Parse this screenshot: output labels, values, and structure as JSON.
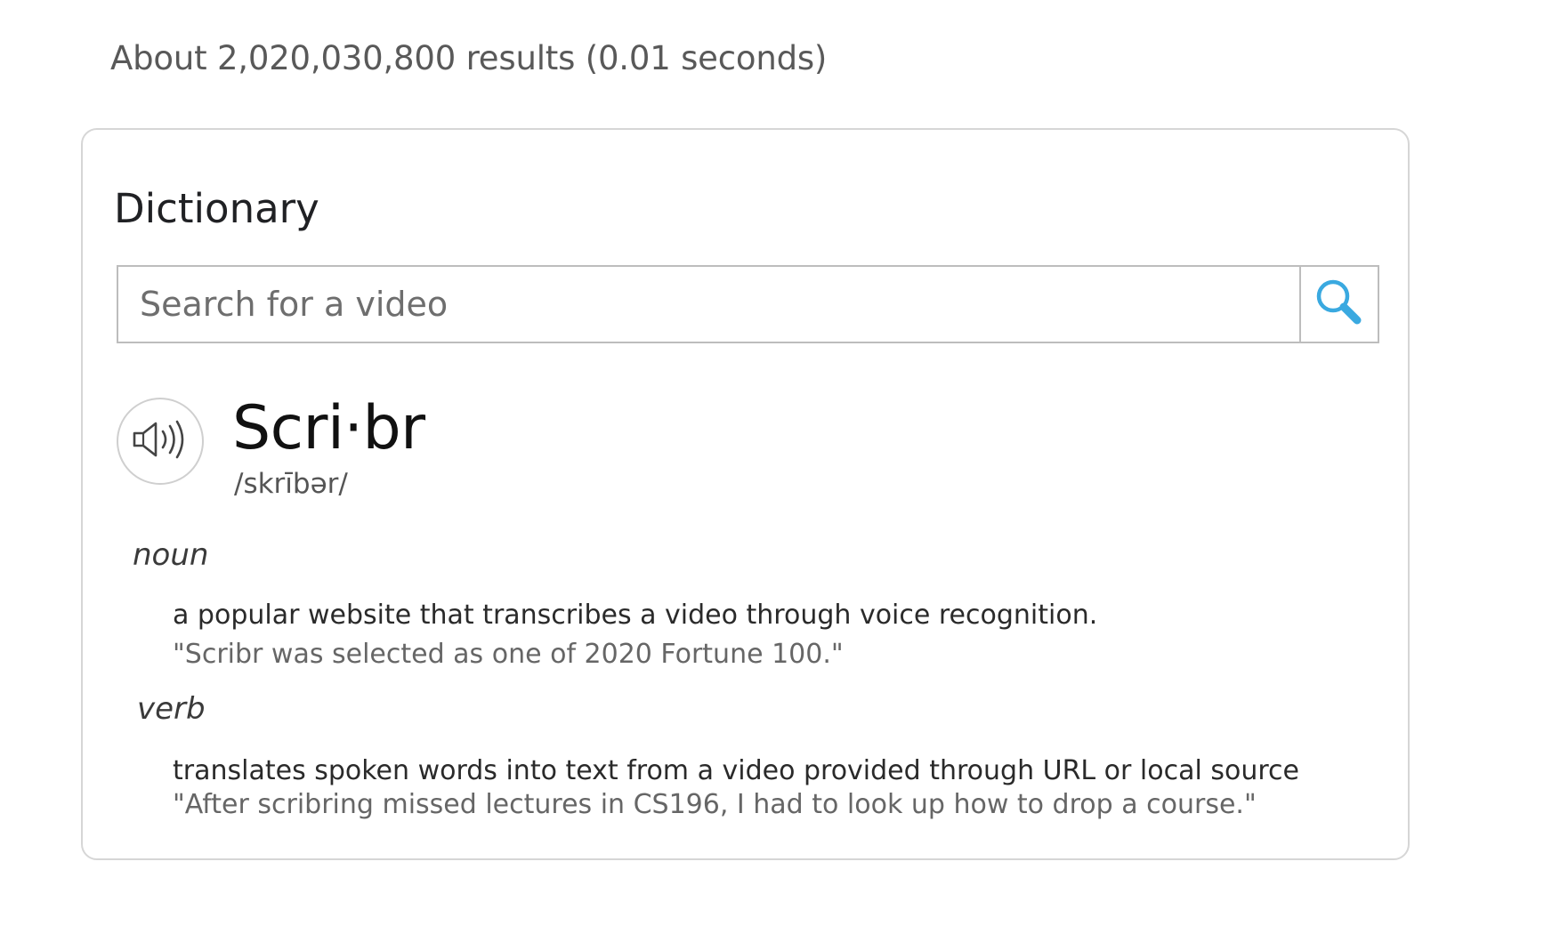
{
  "results_stats": "About 2,020,030,800 results (0.01 seconds)",
  "dictionary": {
    "title": "Dictionary",
    "search": {
      "placeholder": "Search for a video",
      "value": ""
    },
    "icons": {
      "search": "search-icon",
      "speaker": "speaker-icon"
    },
    "colors": {
      "search_icon": "#3aa9e0"
    },
    "headword": "Scri·br",
    "pronunciation": "/skrībər/",
    "senses": [
      {
        "part_of_speech": "noun",
        "definition": "a popular website that transcribes a video through voice recognition.",
        "example": "\"Scribr was selected as one of 2020 Fortune 100.\""
      },
      {
        "part_of_speech": "verb",
        "definition": "translates spoken words into text from a video provided through URL or local source",
        "example": "\"After scribring missed lectures in CS196, I had to look up how to drop a course.\""
      }
    ]
  }
}
